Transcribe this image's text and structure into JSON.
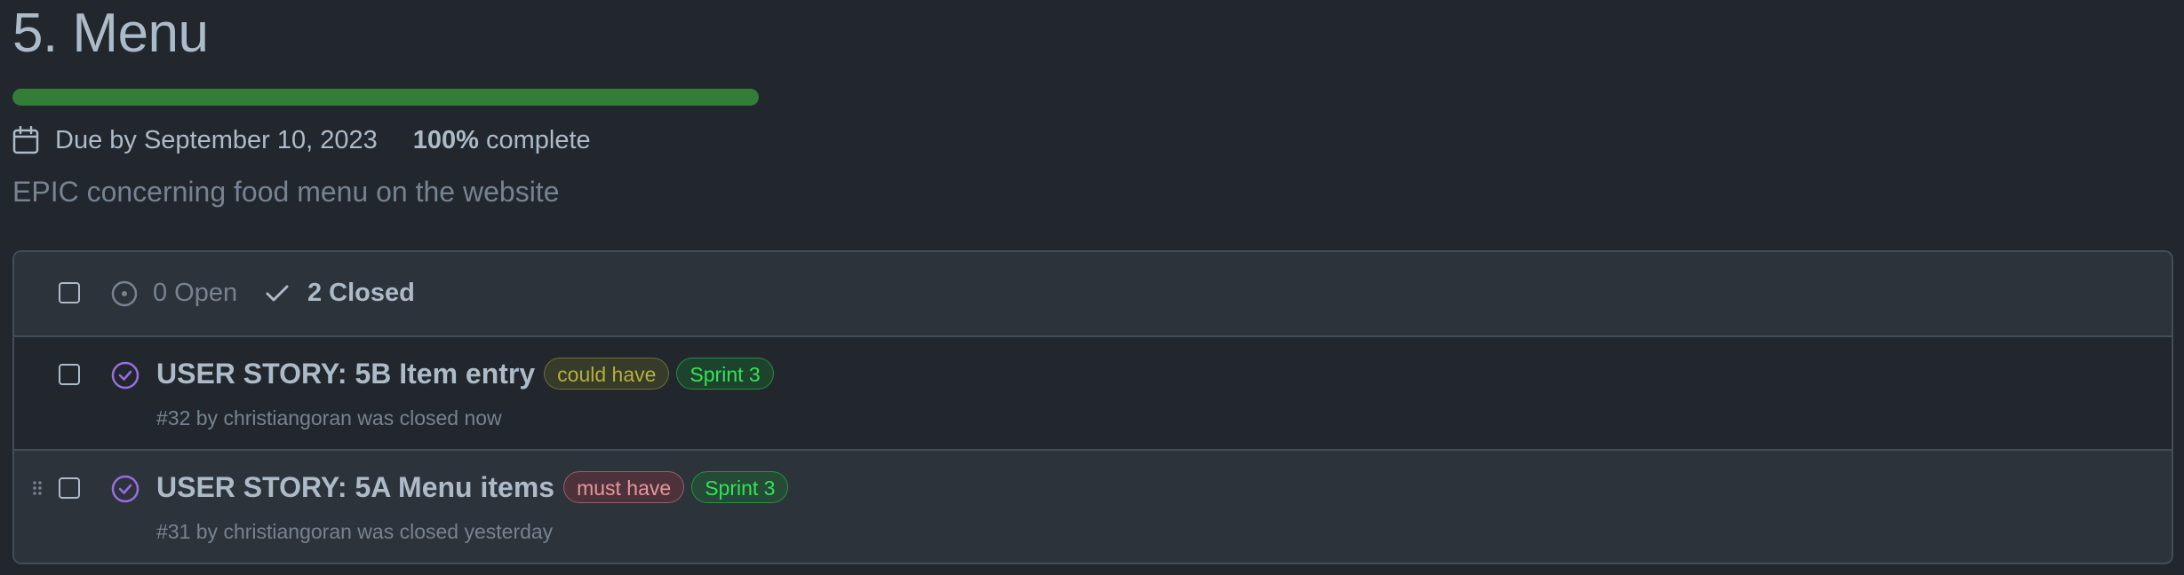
{
  "milestone": {
    "title": "5. Menu",
    "progress_percent": 100,
    "due_text": "Due by September 10, 2023",
    "percent_value": "100%",
    "percent_suffix": "complete",
    "description": "EPIC concerning food menu on the website"
  },
  "issues_header": {
    "open_label": "0 Open",
    "closed_label": "2 Closed"
  },
  "issues": [
    {
      "title": "USER STORY: 5B Item entry",
      "labels": [
        {
          "text": "could have",
          "kind": "could"
        },
        {
          "text": "Sprint 3",
          "kind": "sprint"
        }
      ],
      "subtitle": "#32 by christiangoran was closed now"
    },
    {
      "title": "USER STORY: 5A Menu items",
      "labels": [
        {
          "text": "must have",
          "kind": "must"
        },
        {
          "text": "Sprint 3",
          "kind": "sprint"
        }
      ],
      "subtitle": "#31 by christiangoran was closed yesterday"
    }
  ],
  "colors": {
    "background": "#22272e",
    "progress": "#347d39",
    "closed_icon": "#986ee2",
    "label_could": "#b3b03d",
    "label_must": "#e6969c",
    "label_sprint": "#33e35a"
  },
  "icons": {
    "calendar": "calendar-icon",
    "open": "issue-open-icon",
    "closed_check": "check-icon",
    "issue_closed": "issue-closed-icon",
    "drag": "drag-handle-icon"
  }
}
